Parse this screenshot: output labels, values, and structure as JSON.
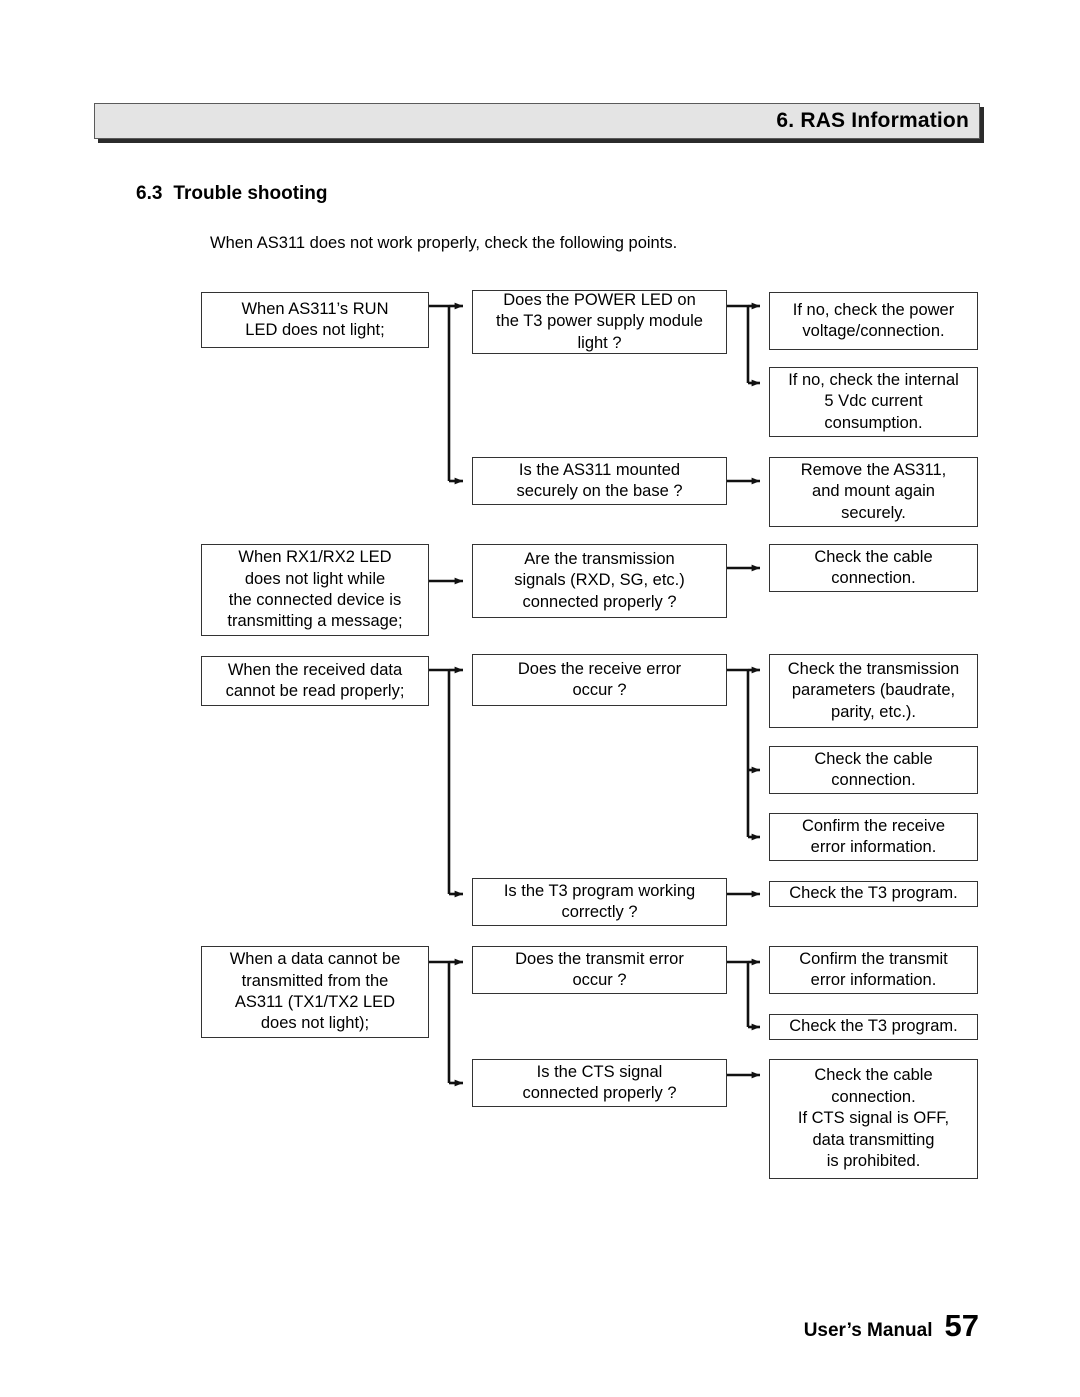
{
  "header": {
    "title": "6. RAS Information"
  },
  "section": {
    "number": "6.3",
    "heading": "Trouble shooting",
    "intro": "When AS311 does not work properly, check the following points."
  },
  "flowchart": {
    "type": "diagram",
    "groups": [
      {
        "symptom": "When AS311’s RUN\nLED does not light;",
        "checks": [
          {
            "question": "Does the POWER LED on\nthe T3 power supply module\nlight ?",
            "actions": [
              "If no, check the power\nvoltage/connection.",
              "If no, check the internal\n5 Vdc current\nconsumption."
            ]
          },
          {
            "question": "Is the AS311 mounted\nsecurely on the base ?",
            "actions": [
              "Remove the AS311,\nand mount again\nsecurely."
            ]
          }
        ]
      },
      {
        "symptom": "When RX1/RX2 LED\ndoes not light while\nthe connected device is\ntransmitting a message;",
        "checks": [
          {
            "question": "Are the transmission\nsignals (RXD, SG, etc.)\nconnected properly ?",
            "actions": [
              "Check the cable\nconnection."
            ]
          }
        ]
      },
      {
        "symptom": "When the received data\ncannot be read properly;",
        "checks": [
          {
            "question": "Does the receive error\noccur ?",
            "actions": [
              "Check the transmission\nparameters (baudrate,\nparity, etc.).",
              "Check the cable\nconnection.",
              "Confirm the receive\nerror information."
            ]
          },
          {
            "question": "Is the T3 program working\ncorrectly ?",
            "actions": [
              "Check the T3 program."
            ]
          }
        ]
      },
      {
        "symptom": "When a data cannot be\ntransmitted from the\nAS311 (TX1/TX2 LED\ndoes not light);",
        "checks": [
          {
            "question": "Does the transmit error\noccur ?",
            "actions": [
              "Confirm the transmit\nerror information.",
              "Check the T3 program."
            ]
          },
          {
            "question": "Is the CTS signal\nconnected properly ?",
            "actions": [
              "Check the cable\nconnection.\nIf CTS signal is OFF,\ndata transmitting\nis prohibited."
            ]
          }
        ]
      }
    ]
  },
  "footer": {
    "label": "User’s Manual",
    "page": "57"
  }
}
